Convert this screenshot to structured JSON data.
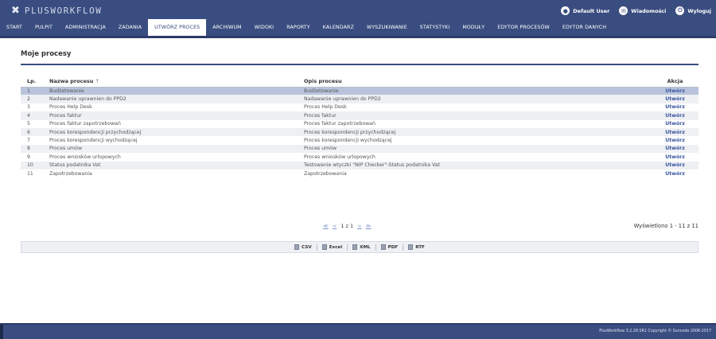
{
  "header": {
    "logo_mark": "✖",
    "logo_text": "PLUSWORKFLOW",
    "user_label": "Default User",
    "user_icon": "user-icon",
    "messages_label": "Wiadomości",
    "messages_icon": "mail-icon",
    "logout_label": "Wyloguj",
    "logout_icon": "power-icon"
  },
  "nav": {
    "items": [
      {
        "label": "START"
      },
      {
        "label": "PULPIT"
      },
      {
        "label": "ADMINISTRACJA"
      },
      {
        "label": "ZADANIA"
      },
      {
        "label": "UTWÓRZ PROCES"
      },
      {
        "label": "ARCHIWUM"
      },
      {
        "label": "WIDOKI"
      },
      {
        "label": "RAPORTY"
      },
      {
        "label": "KALENDARZ"
      },
      {
        "label": "WYSZUKIWANIE"
      },
      {
        "label": "STATYSTYKI"
      },
      {
        "label": "MODUŁY"
      },
      {
        "label": "EDYTOR PROCESÓW"
      },
      {
        "label": "EDYTOR DANYCH"
      }
    ],
    "active_index": 4
  },
  "page": {
    "title": "Moje procesy"
  },
  "table": {
    "headers": {
      "lp": "Lp.",
      "name": "Nazwa procesu",
      "sort_indicator": "↑",
      "desc": "Opis procesu",
      "action": "Akcja"
    },
    "rows": [
      {
        "lp": "1",
        "name": "Budżetowanie",
        "desc": "Budżetowanie",
        "action": "Utwórz"
      },
      {
        "lp": "2",
        "name": "Nadawanie uprawnien do PPD2",
        "desc": "Nadawanie uprawnien do PPD2",
        "action": "Utwórz"
      },
      {
        "lp": "3",
        "name": "Proces Help Desk",
        "desc": "Proces Help Desk",
        "action": "Utwórz"
      },
      {
        "lp": "4",
        "name": "Proces faktur",
        "desc": "Proces faktur",
        "action": "Utwórz"
      },
      {
        "lp": "5",
        "name": "Proces faktur zapotrzebowań",
        "desc": "Proces faktur zapotrzebowań",
        "action": "Utwórz"
      },
      {
        "lp": "6",
        "name": "Proces korespondencji przychodzącej",
        "desc": "Proces korespondencji przychodzącej",
        "action": "Utwórz"
      },
      {
        "lp": "7",
        "name": "Proces korespondencji wychodzącej",
        "desc": "Proces korespondencji wychodzącej",
        "action": "Utwórz"
      },
      {
        "lp": "8",
        "name": "Proces umów",
        "desc": "Proces umów",
        "action": "Utwórz"
      },
      {
        "lp": "9",
        "name": "Proces wniosków urlopowych",
        "desc": "Proces wniosków urlopowych",
        "action": "Utwórz"
      },
      {
        "lp": "10",
        "name": "Status podatnika Vat",
        "desc": "Testowanie wtyczki \"NIP Checker\"-Status podatnika Vat",
        "action": "Utwórz"
      },
      {
        "lp": "11",
        "name": "Zapotrzebowania",
        "desc": "Zapotrzebowania",
        "action": "Utwórz"
      }
    ],
    "selected_index": 0
  },
  "pager": {
    "first": "≪",
    "prev": "<",
    "page_info": "1 z 1",
    "next": ">",
    "last": "≫",
    "summary": "Wyświetlono 1 - 11 z 11"
  },
  "export": {
    "items": [
      {
        "label": "CSV",
        "icon": "csv-icon"
      },
      {
        "label": "Excel",
        "icon": "excel-icon"
      },
      {
        "label": "XML",
        "icon": "xml-icon"
      },
      {
        "label": "PDF",
        "icon": "pdf-icon"
      },
      {
        "label": "RTF",
        "icon": "rtf-icon"
      }
    ]
  },
  "footer": {
    "text": "PlusWorkflow 3.2.28.SR1 Copyright © Suncode 2006-2017"
  },
  "colors": {
    "brand": "#3a4d80",
    "selected_row": "#b9c4dc",
    "action_link": "#3a55a0"
  }
}
